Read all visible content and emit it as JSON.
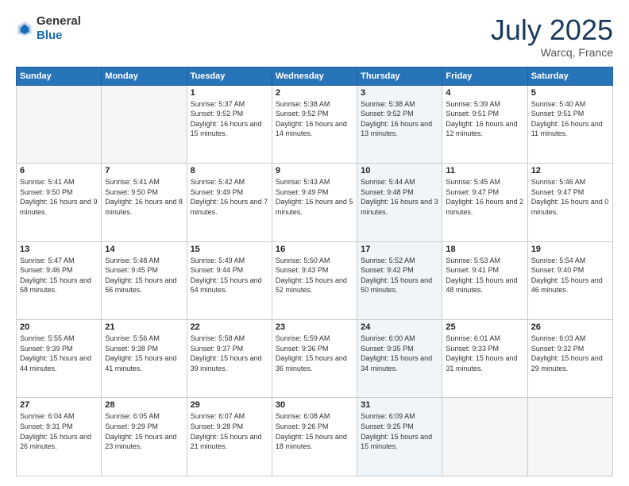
{
  "header": {
    "logo_general": "General",
    "logo_blue": "Blue",
    "title": "July 2025",
    "location": "Warcq, France"
  },
  "weekdays": [
    "Sunday",
    "Monday",
    "Tuesday",
    "Wednesday",
    "Thursday",
    "Friday",
    "Saturday"
  ],
  "weeks": [
    [
      {
        "day": "",
        "empty": true
      },
      {
        "day": "",
        "empty": true
      },
      {
        "day": "1",
        "sunrise": "5:37 AM",
        "sunset": "9:52 PM",
        "daylight": "16 hours and 15 minutes."
      },
      {
        "day": "2",
        "sunrise": "5:38 AM",
        "sunset": "9:52 PM",
        "daylight": "16 hours and 14 minutes."
      },
      {
        "day": "3",
        "sunrise": "5:38 AM",
        "sunset": "9:52 PM",
        "daylight": "16 hours and 13 minutes."
      },
      {
        "day": "4",
        "sunrise": "5:39 AM",
        "sunset": "9:51 PM",
        "daylight": "16 hours and 12 minutes."
      },
      {
        "day": "5",
        "sunrise": "5:40 AM",
        "sunset": "9:51 PM",
        "daylight": "16 hours and 11 minutes."
      }
    ],
    [
      {
        "day": "6",
        "sunrise": "5:41 AM",
        "sunset": "9:50 PM",
        "daylight": "16 hours and 9 minutes."
      },
      {
        "day": "7",
        "sunrise": "5:41 AM",
        "sunset": "9:50 PM",
        "daylight": "16 hours and 8 minutes."
      },
      {
        "day": "8",
        "sunrise": "5:42 AM",
        "sunset": "9:49 PM",
        "daylight": "16 hours and 7 minutes."
      },
      {
        "day": "9",
        "sunrise": "5:43 AM",
        "sunset": "9:49 PM",
        "daylight": "16 hours and 5 minutes."
      },
      {
        "day": "10",
        "sunrise": "5:44 AM",
        "sunset": "9:48 PM",
        "daylight": "16 hours and 3 minutes."
      },
      {
        "day": "11",
        "sunrise": "5:45 AM",
        "sunset": "9:47 PM",
        "daylight": "16 hours and 2 minutes."
      },
      {
        "day": "12",
        "sunrise": "5:46 AM",
        "sunset": "9:47 PM",
        "daylight": "16 hours and 0 minutes."
      }
    ],
    [
      {
        "day": "13",
        "sunrise": "5:47 AM",
        "sunset": "9:46 PM",
        "daylight": "15 hours and 58 minutes."
      },
      {
        "day": "14",
        "sunrise": "5:48 AM",
        "sunset": "9:45 PM",
        "daylight": "15 hours and 56 minutes."
      },
      {
        "day": "15",
        "sunrise": "5:49 AM",
        "sunset": "9:44 PM",
        "daylight": "15 hours and 54 minutes."
      },
      {
        "day": "16",
        "sunrise": "5:50 AM",
        "sunset": "9:43 PM",
        "daylight": "15 hours and 52 minutes."
      },
      {
        "day": "17",
        "sunrise": "5:52 AM",
        "sunset": "9:42 PM",
        "daylight": "15 hours and 50 minutes."
      },
      {
        "day": "18",
        "sunrise": "5:53 AM",
        "sunset": "9:41 PM",
        "daylight": "15 hours and 48 minutes."
      },
      {
        "day": "19",
        "sunrise": "5:54 AM",
        "sunset": "9:40 PM",
        "daylight": "15 hours and 46 minutes."
      }
    ],
    [
      {
        "day": "20",
        "sunrise": "5:55 AM",
        "sunset": "9:39 PM",
        "daylight": "15 hours and 44 minutes."
      },
      {
        "day": "21",
        "sunrise": "5:56 AM",
        "sunset": "9:38 PM",
        "daylight": "15 hours and 41 minutes."
      },
      {
        "day": "22",
        "sunrise": "5:58 AM",
        "sunset": "9:37 PM",
        "daylight": "15 hours and 39 minutes."
      },
      {
        "day": "23",
        "sunrise": "5:59 AM",
        "sunset": "9:36 PM",
        "daylight": "15 hours and 36 minutes."
      },
      {
        "day": "24",
        "sunrise": "6:00 AM",
        "sunset": "9:35 PM",
        "daylight": "15 hours and 34 minutes."
      },
      {
        "day": "25",
        "sunrise": "6:01 AM",
        "sunset": "9:33 PM",
        "daylight": "15 hours and 31 minutes."
      },
      {
        "day": "26",
        "sunrise": "6:03 AM",
        "sunset": "9:32 PM",
        "daylight": "15 hours and 29 minutes."
      }
    ],
    [
      {
        "day": "27",
        "sunrise": "6:04 AM",
        "sunset": "9:31 PM",
        "daylight": "15 hours and 26 minutes."
      },
      {
        "day": "28",
        "sunrise": "6:05 AM",
        "sunset": "9:29 PM",
        "daylight": "15 hours and 23 minutes."
      },
      {
        "day": "29",
        "sunrise": "6:07 AM",
        "sunset": "9:28 PM",
        "daylight": "15 hours and 21 minutes."
      },
      {
        "day": "30",
        "sunrise": "6:08 AM",
        "sunset": "9:26 PM",
        "daylight": "15 hours and 18 minutes."
      },
      {
        "day": "31",
        "sunrise": "6:09 AM",
        "sunset": "9:25 PM",
        "daylight": "15 hours and 15 minutes."
      },
      {
        "day": "",
        "empty": true
      },
      {
        "day": "",
        "empty": true
      }
    ]
  ]
}
